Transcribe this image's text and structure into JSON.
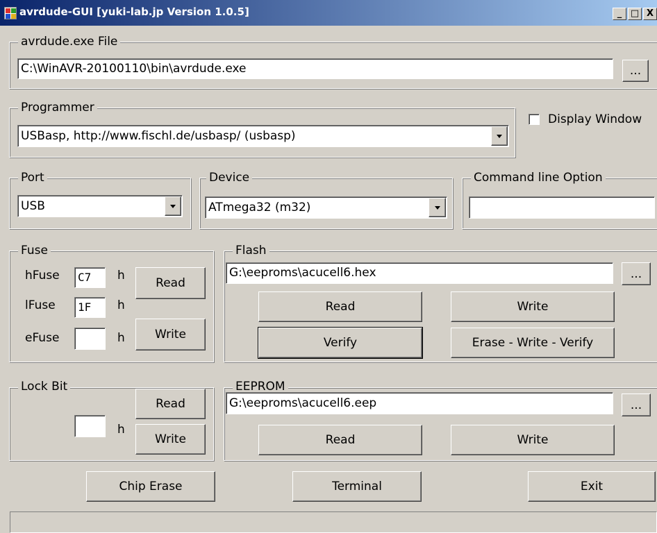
{
  "window": {
    "title": "avrdude-GUI [yuki-lab.jp Version 1.0.5]",
    "minimize_label": "_",
    "maximize_label": "□",
    "close_label": "X"
  },
  "avrdude_file": {
    "legend": "avrdude.exe File",
    "path": "C:\\WinAVR-20100110\\bin\\avrdude.exe",
    "browse_label": "..."
  },
  "programmer": {
    "legend": "Programmer",
    "selected": "USBasp, http://www.fischl.de/usbasp/ (usbasp)",
    "display_window_label": "Display Window",
    "display_window_checked": false
  },
  "port": {
    "legend": "Port",
    "selected": "USB"
  },
  "device": {
    "legend": "Device",
    "selected": "ATmega32 (m32)"
  },
  "command_line": {
    "legend": "Command line Option",
    "value": ""
  },
  "fuse": {
    "legend": "Fuse",
    "hfuse_label": "hFuse",
    "hfuse_value": "C7",
    "lfuse_label": "lFuse",
    "lfuse_value": "1F",
    "efuse_label": "eFuse",
    "efuse_value": "",
    "hex_suffix": "h",
    "read_label": "Read",
    "write_label": "Write"
  },
  "flash": {
    "legend": "Flash",
    "path": "G:\\eeproms\\acucell6.hex",
    "browse_label": "...",
    "read_label": "Read",
    "write_label": "Write",
    "verify_label": "Verify",
    "erase_write_verify_label": "Erase - Write - Verify"
  },
  "lock_bit": {
    "legend": "Lock Bit",
    "value": "",
    "hex_suffix": "h",
    "read_label": "Read",
    "write_label": "Write"
  },
  "eeprom": {
    "legend": "EEPROM",
    "path": "G:\\eeproms\\acucell6.eep",
    "browse_label": "...",
    "read_label": "Read",
    "write_label": "Write"
  },
  "footer": {
    "chip_erase_label": "Chip Erase",
    "terminal_label": "Terminal",
    "exit_label": "Exit",
    "status_text": ""
  },
  "colors": {
    "titlebar_start": "#0a246a",
    "titlebar_end": "#a6caf0",
    "face": "#d4d0c8"
  }
}
